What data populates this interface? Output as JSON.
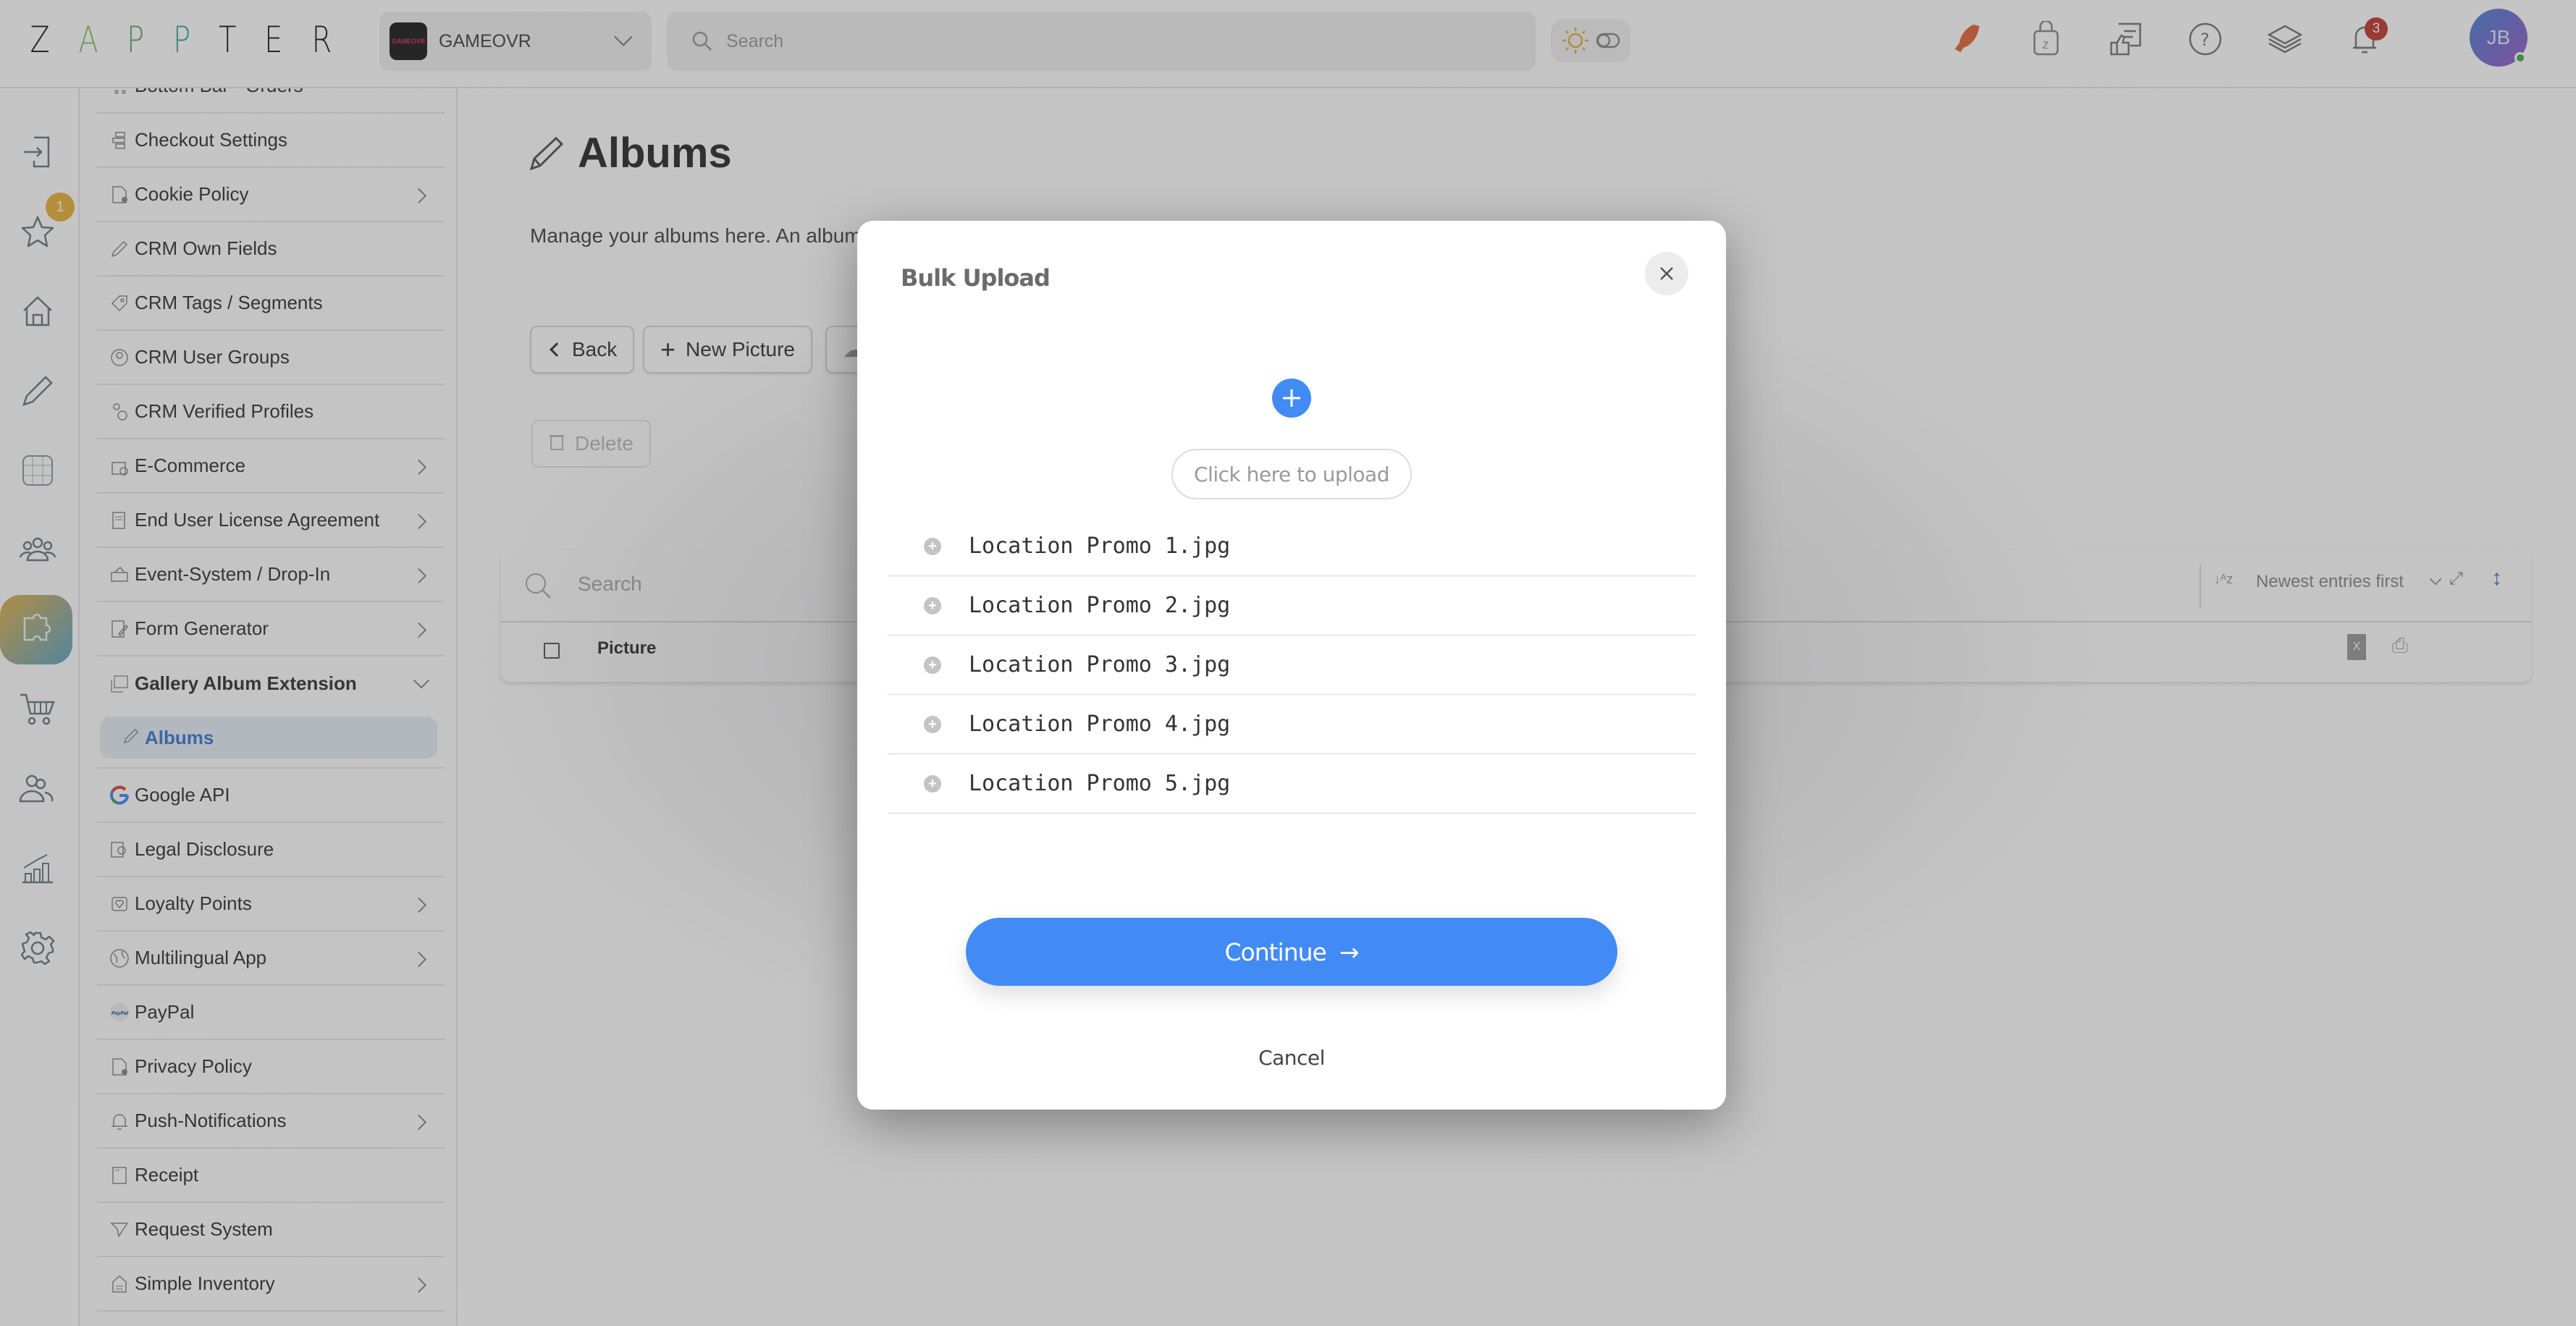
{
  "app": {
    "logo_letters": [
      "Z",
      "A",
      "P",
      "P",
      "T",
      "E",
      "R"
    ],
    "logo_colors": [
      "#222222",
      "#8fbf6a",
      "#5aa86f",
      "#3fa88f",
      "#222222",
      "#222222",
      "#222222"
    ]
  },
  "header": {
    "tenant": {
      "logo_text": "GAMEOVR",
      "name": "GAMEOVR"
    },
    "search_placeholder": "Search",
    "notifications_count": "3",
    "avatar_initials": "JB",
    "icons": [
      "rocket-icon",
      "shopping-bag-icon",
      "feedback-icon",
      "help-icon",
      "layers-icon",
      "bell-icon"
    ]
  },
  "rail": {
    "favorites_badge": "1",
    "items": [
      "login-icon",
      "star-icon",
      "home-icon",
      "pencil-icon",
      "grid-icon",
      "users-icon",
      "puzzle-icon",
      "cart-icon",
      "groups-icon",
      "chart-icon",
      "gear-icon"
    ]
  },
  "sidebar": {
    "items": [
      {
        "label": "Bottom Bar - Orders",
        "arrow": false
      },
      {
        "label": "Checkout Settings",
        "arrow": false
      },
      {
        "label": "Cookie Policy",
        "arrow": true
      },
      {
        "label": "CRM Own Fields",
        "arrow": false
      },
      {
        "label": "CRM Tags / Segments",
        "arrow": false
      },
      {
        "label": "CRM User Groups",
        "arrow": false
      },
      {
        "label": "CRM Verified Profiles",
        "arrow": false
      },
      {
        "label": "E-Commerce",
        "arrow": true
      },
      {
        "label": "End User License Agreement",
        "arrow": true
      },
      {
        "label": "Event-System / Drop-In",
        "arrow": true
      },
      {
        "label": "Form Generator",
        "arrow": true
      },
      {
        "label": "Gallery Album Extension",
        "arrow": false,
        "expanded": true
      },
      {
        "label": "Google API",
        "arrow": false
      },
      {
        "label": "Legal Disclosure",
        "arrow": false
      },
      {
        "label": "Loyalty Points",
        "arrow": true
      },
      {
        "label": "Multilingual App",
        "arrow": true
      },
      {
        "label": "PayPal",
        "arrow": false
      },
      {
        "label": "Privacy Policy",
        "arrow": false
      },
      {
        "label": "Push-Notifications",
        "arrow": true
      },
      {
        "label": "Receipt",
        "arrow": false
      },
      {
        "label": "Request System",
        "arrow": false
      },
      {
        "label": "Simple Inventory",
        "arrow": true
      }
    ],
    "active_subitem": "Albums"
  },
  "page": {
    "title": "Albums",
    "description": "Manage your albums here. An album",
    "buttons": {
      "back": "Back",
      "new_picture": "New Picture",
      "delete": "Delete"
    },
    "table": {
      "search_placeholder": "Search",
      "sort_label": "Newest entries first",
      "columns": [
        "Picture"
      ]
    }
  },
  "modal": {
    "title": "Bulk Upload",
    "upload_label": "Click here to upload",
    "files": [
      "Location Promo 1.jpg",
      "Location Promo 2.jpg",
      "Location Promo 3.jpg",
      "Location Promo 4.jpg",
      "Location Promo 5.jpg"
    ],
    "continue_label": "Continue",
    "cancel_label": "Cancel",
    "accent": "#428bf5"
  }
}
